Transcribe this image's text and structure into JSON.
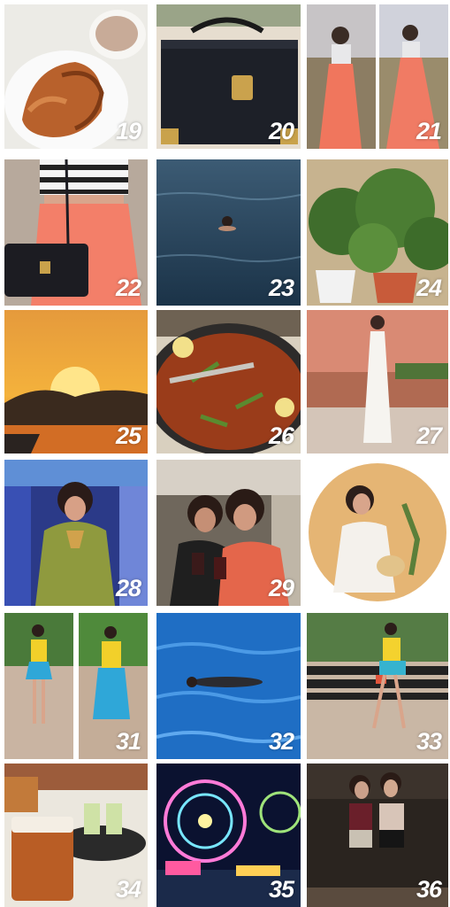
{
  "collage": {
    "labels": {
      "t19": "19",
      "t20": "20",
      "t21": "21",
      "t22": "22",
      "t23": "23",
      "t24": "24",
      "t25": "25",
      "t26": "26",
      "t27": "27",
      "t28": "28",
      "t29": "29",
      "t31": "31",
      "t32": "32",
      "t33": "33",
      "t34": "34",
      "t35": "35",
      "t36": "36"
    }
  }
}
